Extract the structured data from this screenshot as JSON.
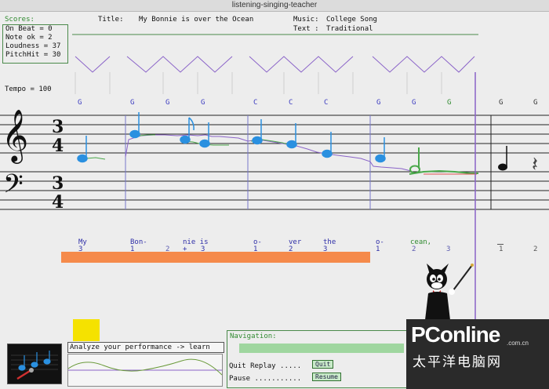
{
  "window": {
    "title": "listening-singing-teacher"
  },
  "scores": {
    "header": "Scores:",
    "lines": [
      "On Beat  = 0",
      "Note ok  = 2",
      "Loudness = 37",
      "PitchHit = 30"
    ]
  },
  "song": {
    "title_label": "Title:",
    "title": "My Bonnie is over the Ocean",
    "music_label": "Music:",
    "music": "College Song",
    "text_label": "Text :",
    "text": "Traditional"
  },
  "tempo": "Tempo = 100",
  "chords": [
    "G",
    "G",
    "G",
    "G",
    "C",
    "C",
    "C",
    "G",
    "G",
    "G",
    "G",
    "G"
  ],
  "lyrics": [
    "My",
    "Bon-",
    "nie is",
    "o-",
    "ver",
    "the",
    "o-",
    "cean,"
  ],
  "beats": [
    "3",
    "1",
    "2",
    "+",
    "3",
    "1",
    "2",
    "3",
    "1",
    "2",
    "3",
    "1",
    "2"
  ],
  "analyze": {
    "label": "Analyze your performance -> learn"
  },
  "navigation": {
    "title": "Navigation:",
    "quit_label": "Quit Replay .....",
    "quit_button": "Quit",
    "pause_label": "Pause ...........",
    "resume_button": "Resume"
  },
  "watermark": {
    "brand": "PConline",
    "domain": ".com.cn",
    "cn": "太平洋电脑网"
  },
  "colors": {
    "lyric": "#2f2fa8",
    "progress": "#f58a4b",
    "nav_bar": "#9fd69f",
    "panel_border": "#4a8a4a"
  }
}
